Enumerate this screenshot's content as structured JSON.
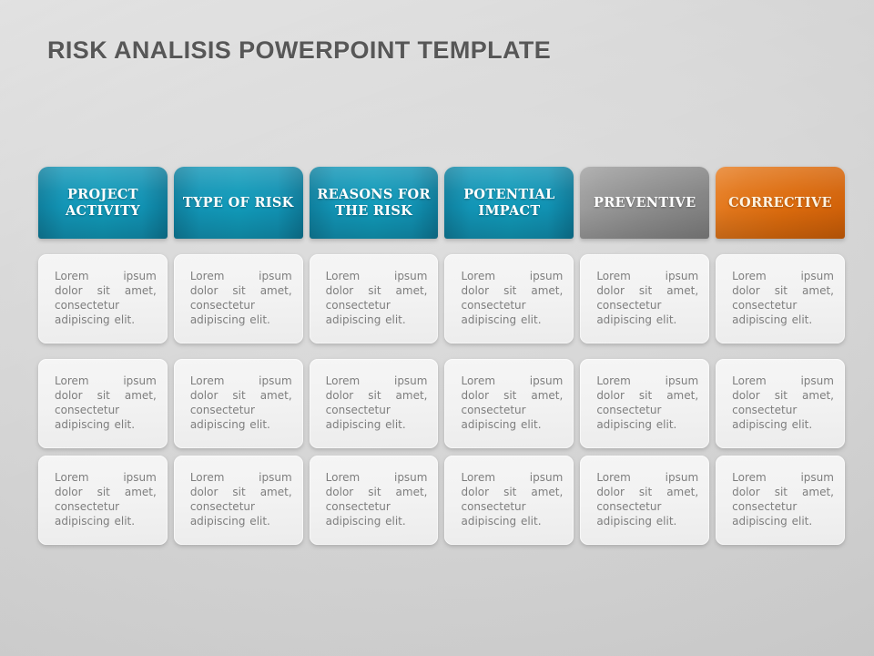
{
  "slide": {
    "title": "RISK ANALISIS POWERPOINT TEMPLATE",
    "background_color": "#d6d6d6",
    "title_color": "#575757"
  },
  "colors": {
    "teal": "#119ab9",
    "gray": "#8d8d8d",
    "orange": "#dc6b0d",
    "card": "#f2f2f2",
    "card_text": "#7e7e7e",
    "header_text": "#ffffff"
  },
  "table": {
    "columns": [
      {
        "header": "PROJECT ACTIVITY",
        "style": "teal"
      },
      {
        "header": "TYPE OF RISK",
        "style": "teal"
      },
      {
        "header": "REASONS FOR THE RISK",
        "style": "teal"
      },
      {
        "header": "POTENTIAL IMPACT",
        "style": "teal"
      },
      {
        "header": "PREVENTIVE",
        "style": "gray"
      },
      {
        "header": "CORRECTIVE",
        "style": "orange"
      }
    ],
    "rows": [
      [
        "Lorem ipsum dolor sit amet, consectetur adipiscing elit.",
        "Lorem ipsum dolor sit amet, consectetur adipiscing elit.",
        "Lorem ipsum dolor sit amet, consectetur adipiscing elit.",
        "Lorem ipsum dolor sit amet, consectetur adipiscing elit.",
        "Lorem ipsum dolor sit amet, consectetur adipiscing elit.",
        "Lorem ipsum dolor sit amet, consectetur adipiscing elit."
      ],
      [
        "Lorem ipsum dolor sit amet, consectetur adipiscing elit.",
        "Lorem ipsum dolor sit amet, consectetur adipiscing elit.",
        "Lorem ipsum dolor sit amet, consectetur adipiscing elit.",
        "Lorem ipsum dolor sit amet, consectetur adipiscing elit.",
        "Lorem ipsum dolor sit amet, consectetur adipiscing elit.",
        "Lorem ipsum dolor sit amet, consectetur adipiscing elit."
      ],
      [
        "Lorem ipsum dolor sit amet, consectetur adipiscing elit.",
        "Lorem ipsum dolor sit amet, consectetur adipiscing elit.",
        "Lorem ipsum dolor sit amet, consectetur adipiscing elit.",
        "Lorem ipsum dolor sit amet, consectetur adipiscing elit.",
        "Lorem ipsum dolor sit amet, consectetur adipiscing elit.",
        "Lorem ipsum dolor sit amet, consectetur adipiscing elit."
      ]
    ]
  }
}
